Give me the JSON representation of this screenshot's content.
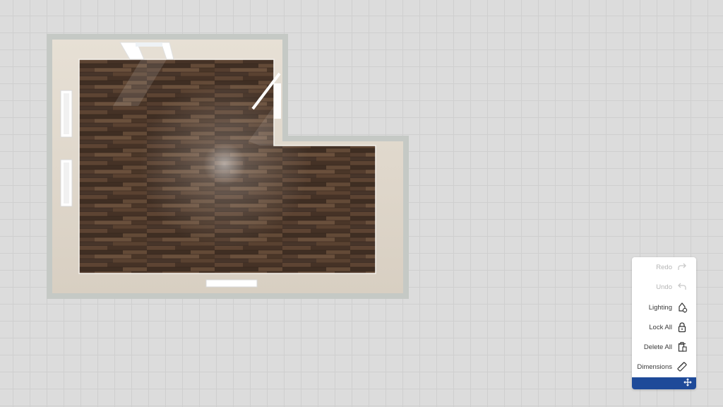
{
  "toolbar": {
    "redo": {
      "label": "Redo",
      "icon": "redo-icon",
      "enabled": false
    },
    "undo": {
      "label": "Undo",
      "icon": "undo-icon",
      "enabled": false
    },
    "lighting": {
      "label": "Lighting",
      "icon": "lightbulb-icon",
      "enabled": true
    },
    "lock_all": {
      "label": "Lock All",
      "icon": "lock-icon",
      "enabled": true
    },
    "delete_all": {
      "label": "Delete All",
      "icon": "trash-icon",
      "enabled": true
    },
    "dimensions": {
      "label": "Dimensions",
      "icon": "ruler-icon",
      "enabled": true
    },
    "drag_handle": {
      "icon": "move-icon"
    }
  },
  "colors": {
    "canvas_bg": "#dcdcdc",
    "grid_line": "#cfcfcf",
    "wall_outer": "#c5c9c5",
    "wall_inner": "#ded6ca",
    "floor_wood": "#4f3a2c",
    "accent": "#1e4a99"
  }
}
